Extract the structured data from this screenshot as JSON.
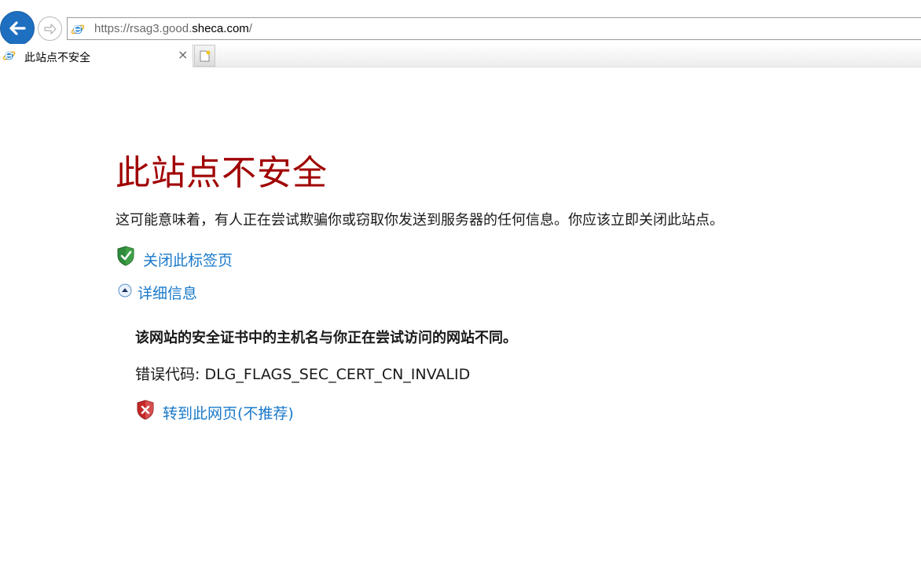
{
  "browser": {
    "address": {
      "prefix": "https://rsag3.good.",
      "domain": "sheca.com",
      "suffix": "/"
    },
    "tab": {
      "title": "此站点不安全",
      "close_glyph": "×"
    },
    "icons": {
      "back": "back-arrow-icon",
      "forward": "forward-arrow-icon",
      "page": "ie-logo-icon",
      "new_tab": "new-tab-icon"
    }
  },
  "page": {
    "heading": "此站点不安全",
    "description": "这可能意味着，有人正在尝试欺骗你或窃取你发送到服务器的任何信息。你应该立即关闭此站点。",
    "close_tab_link": "关闭此标签页",
    "details_link": "详细信息",
    "details": {
      "summary": "该网站的安全证书中的主机名与你正在尝试访问的网站不同。",
      "error_code_label": "错误代码: ",
      "error_code": "DLG_FLAGS_SEC_CERT_CN_INVALID",
      "proceed_link": "转到此网页(不推荐)"
    }
  },
  "colors": {
    "heading": "#a00000",
    "link": "#1979ca",
    "back_button": "#1e6fc0"
  }
}
